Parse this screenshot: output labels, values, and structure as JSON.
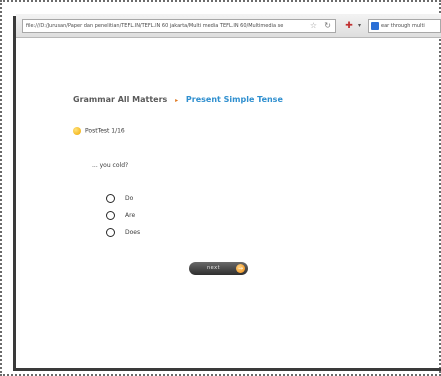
{
  "browser": {
    "url": "file:///D:/Jurusan/Paper dan penelitian/TEFL.IN/TEFL.IN 60 jakarta/Multi media TEFL.IN 60/Multimedia se",
    "search_text": "ear through multi"
  },
  "header": {
    "app_title": "Grammar All Matters",
    "separator": "▸",
    "section_title": "Present Simple Tense"
  },
  "test": {
    "label": "PostTest 1/16"
  },
  "question": {
    "text": "... you cold?",
    "options": [
      {
        "label": "Do"
      },
      {
        "label": "Are"
      },
      {
        "label": "Does"
      }
    ]
  },
  "controls": {
    "next_label": "next",
    "next_icon": "→"
  },
  "colors": {
    "breadcrumb_root": "#5a5a5a",
    "breadcrumb_separator": "#e07820",
    "breadcrumb_current": "#2f8fcf",
    "test_dot": "#f0a800",
    "next_button": "#3a3a3a",
    "next_icon": "#ee8a10"
  },
  "icons": {
    "test_status": "yellow-dot-icon",
    "next": "orange-arrow-icon"
  }
}
